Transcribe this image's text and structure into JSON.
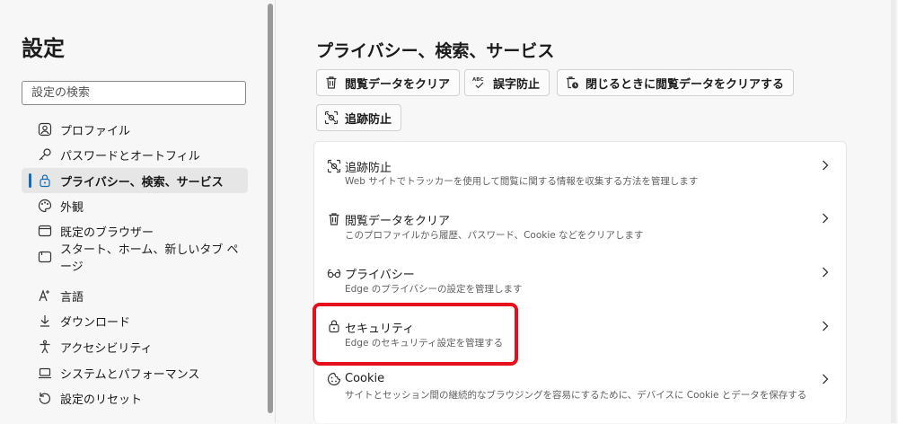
{
  "sidebar": {
    "title": "設定",
    "search_placeholder": "設定の検索",
    "items": [
      {
        "label": "プロファイル",
        "icon": "profile-icon"
      },
      {
        "label": "パスワードとオートフィル",
        "icon": "key-icon"
      },
      {
        "label": "プライバシー、検索、サービス",
        "icon": "lock-icon",
        "selected": true
      },
      {
        "label": "外観",
        "icon": "palette-icon"
      },
      {
        "label": "既定のブラウザー",
        "icon": "browser-icon"
      },
      {
        "label": "スタート、ホーム、新しいタブ ページ",
        "icon": "home-page-icon"
      },
      {
        "label": "言語",
        "icon": "language-icon"
      },
      {
        "label": "ダウンロード",
        "icon": "download-icon"
      },
      {
        "label": "アクセシビリティ",
        "icon": "accessibility-icon"
      },
      {
        "label": "システムとパフォーマンス",
        "icon": "laptop-icon"
      },
      {
        "label": "設定のリセット",
        "icon": "reset-icon"
      }
    ]
  },
  "main": {
    "title": "プライバシー、検索、サービス",
    "quick_links": [
      {
        "label": "閲覧データをクリア",
        "icon": "trash-icon"
      },
      {
        "label": "誤字防止",
        "icon": "spellcheck-icon"
      },
      {
        "label": "閉じるときに閲覧データをクリアする",
        "icon": "trash-clock-icon"
      },
      {
        "label": "追跡防止",
        "icon": "tracking-icon"
      }
    ],
    "rows": [
      {
        "title": "追跡防止",
        "desc": "Web サイトでトラッカーを使用して閲覧に関する情報を収集する方法を管理します",
        "icon": "tracking-icon"
      },
      {
        "title": "閲覧データをクリア",
        "desc": "このプロファイルから履歴、パスワード、Cookie などをクリアします",
        "icon": "trash-icon"
      },
      {
        "title": "プライバシー",
        "desc": "Edge のプライバシーの設定を管理します",
        "icon": "glasses-icon"
      },
      {
        "title": "セキュリティ",
        "desc": "Edge のセキュリティ設定を管理する",
        "icon": "lock-icon"
      },
      {
        "title": "Cookie",
        "desc": "サイトとセッション間の継続的なブラウジングを容易にするために、デバイスに Cookie とデータを保存する",
        "icon": "cookie-icon"
      }
    ]
  },
  "colors": {
    "accent": "#0f6cbd",
    "highlight": "#e5101c"
  }
}
